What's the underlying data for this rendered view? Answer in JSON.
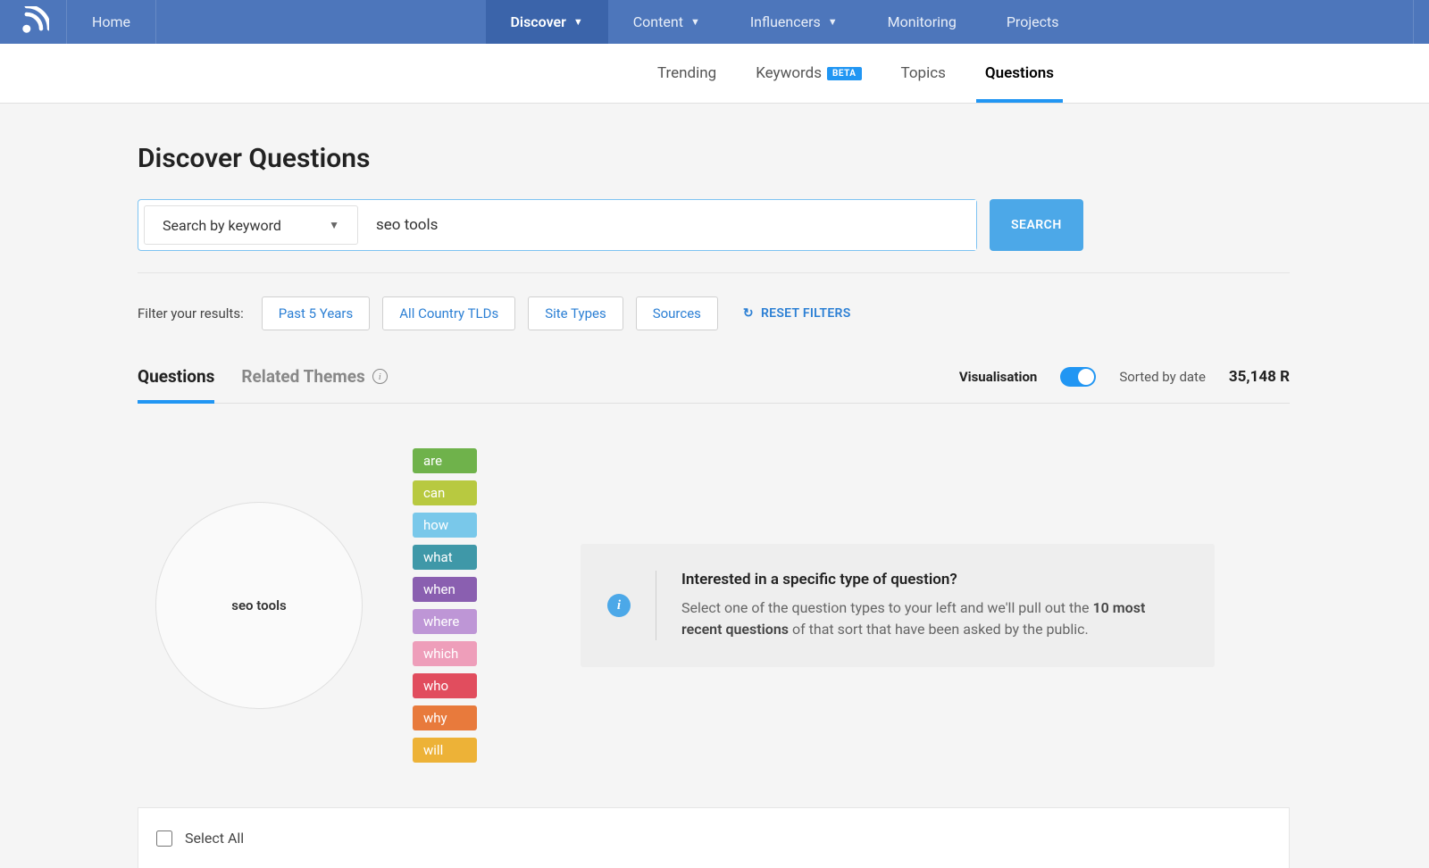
{
  "nav": {
    "home": "Home",
    "items": [
      "Discover",
      "Content",
      "Influencers",
      "Monitoring",
      "Projects"
    ],
    "active": 0,
    "hasDropdown": [
      true,
      true,
      true,
      false,
      false
    ]
  },
  "subnav": {
    "items": [
      "Trending",
      "Keywords",
      "Topics",
      "Questions"
    ],
    "betaIndex": 1,
    "activeIndex": 3
  },
  "page": {
    "title": "Discover Questions"
  },
  "search": {
    "typeLabel": "Search by keyword",
    "value": "seo tools",
    "button": "SEARCH"
  },
  "filters": {
    "label": "Filter your results:",
    "pills": [
      "Past 5 Years",
      "All Country TLDs",
      "Site Types",
      "Sources"
    ],
    "reset": "RESET FILTERS"
  },
  "tabs": {
    "items": [
      "Questions",
      "Related Themes"
    ],
    "activeIndex": 0,
    "visLabel": "Visualisation",
    "sortedBy": "Sorted by date",
    "resultCount": "35,148 R"
  },
  "circle": {
    "text": "seo tools"
  },
  "qtypes": [
    {
      "label": "are",
      "color": "#6fb24b"
    },
    {
      "label": "can",
      "color": "#b8c940"
    },
    {
      "label": "how",
      "color": "#79c8ea"
    },
    {
      "label": "what",
      "color": "#3f98a8"
    },
    {
      "label": "when",
      "color": "#8a5fb0"
    },
    {
      "label": "where",
      "color": "#be96d6"
    },
    {
      "label": "which",
      "color": "#ee9eba"
    },
    {
      "label": "who",
      "color": "#e14d5e"
    },
    {
      "label": "why",
      "color": "#e87a3c"
    },
    {
      "label": "will",
      "color": "#edb237"
    }
  ],
  "info": {
    "title": "Interested in a specific type of question?",
    "bodyPrefix": "Select one of the question types to your left and we'll pull out the ",
    "bodyStrong": "10 most recent questions",
    "bodySuffix": " of that sort that have been asked by the public."
  },
  "lower": {
    "selectAll": "Select All"
  }
}
